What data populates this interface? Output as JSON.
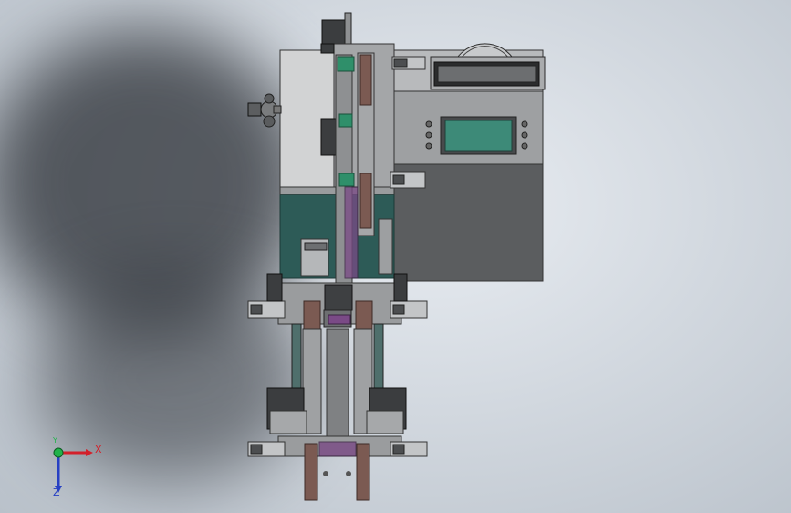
{
  "viewport": {
    "background_color": "#d6dbe1",
    "shadow_color": "#2a2e34"
  },
  "model": {
    "frame_color": "#9a9c9e",
    "panel_light": "#d2d3d4",
    "panel_dark": "#565859",
    "teal_panel": "#2d5b57",
    "screen_color": "#3d8a78",
    "brown_part": "#7b5a52",
    "purple_part": "#7a4a86"
  },
  "triad": {
    "x_label": "X",
    "y_label": "Y",
    "z_label": "Z",
    "x_color": "#d3202a",
    "y_color": "#21b34a",
    "z_color": "#2740c4"
  }
}
